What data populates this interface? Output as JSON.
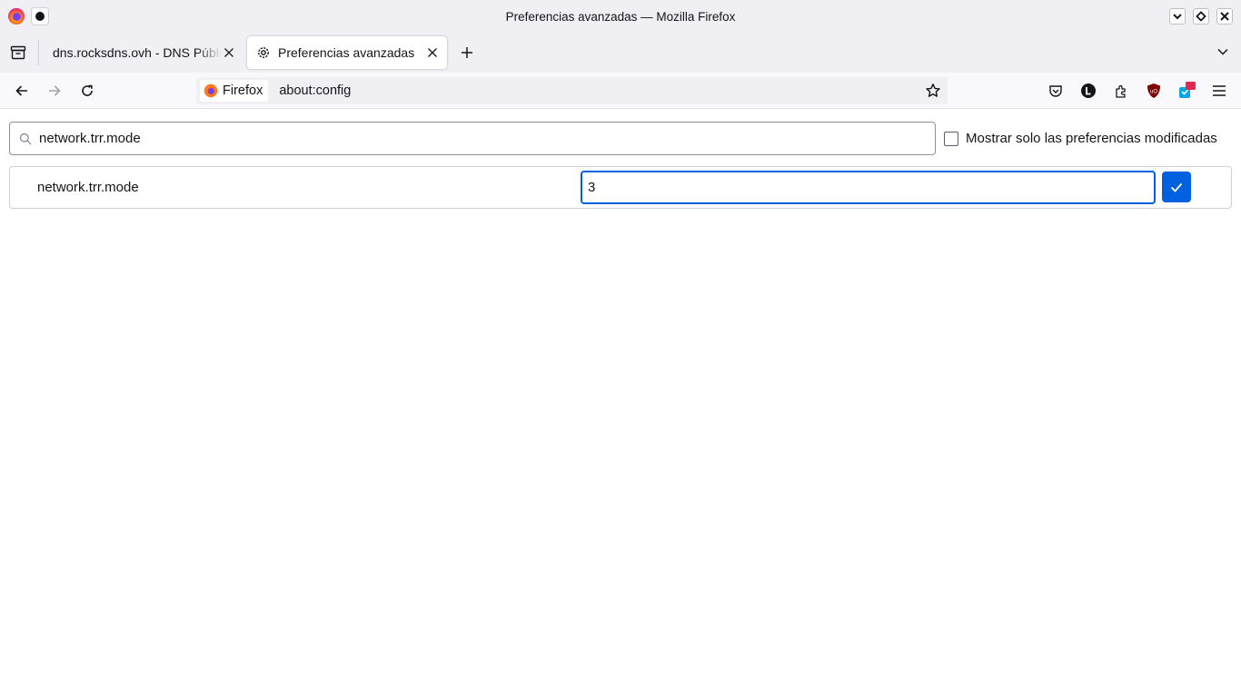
{
  "window": {
    "title": "Preferencias avanzadas — Mozilla Firefox"
  },
  "tabs": [
    {
      "label": "dns.rocksdns.ovh - DNS Públicos",
      "active": false
    },
    {
      "label": "Preferencias avanzadas",
      "active": true,
      "icon": "gear-icon"
    }
  ],
  "urlbar": {
    "identity_label": "Firefox",
    "url": "about:config"
  },
  "toolbar_extensions": [
    "pocket-icon",
    "lastpass-icon",
    "extensions-icon",
    "ublock-origin-icon",
    "notification-extension-icon",
    "menu-icon"
  ],
  "config": {
    "search_value": "network.trr.mode",
    "modified_only_label": "Mostrar solo las preferencias modificadas",
    "modified_only_checked": false,
    "rows": [
      {
        "name": "network.trr.mode",
        "edit_value": "3"
      }
    ]
  },
  "colors": {
    "accent": "#0061e0",
    "chrome_bg": "#f0f0f4",
    "ublock_red": "#800000",
    "badge_red": "#e22850"
  }
}
